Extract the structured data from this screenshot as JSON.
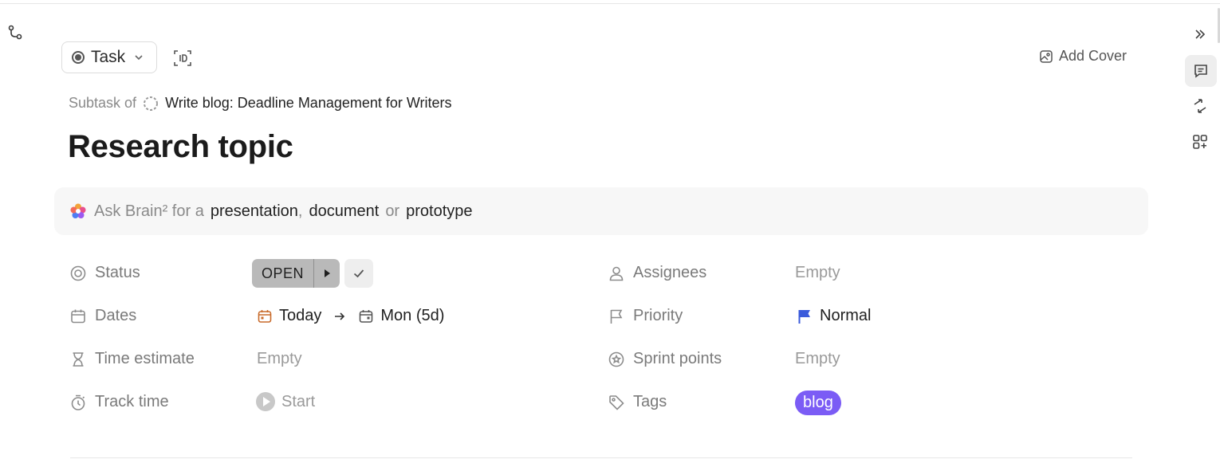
{
  "header": {
    "task_type_label": "Task",
    "add_cover_label": "Add Cover"
  },
  "breadcrumb": {
    "prefix": "Subtask of",
    "parent_task": "Write blog: Deadline Management for Writers"
  },
  "task": {
    "title": "Research topic"
  },
  "brain_bar": {
    "prefix": "Ask Brain² for a",
    "option1": "presentation",
    "sep1": ",",
    "option2": "document",
    "sep2": "or",
    "option3": "prototype"
  },
  "properties": {
    "status": {
      "label": "Status",
      "value": "OPEN"
    },
    "dates": {
      "label": "Dates",
      "start": "Today",
      "end": "Mon (5d)"
    },
    "time_estimate": {
      "label": "Time estimate",
      "value": "Empty"
    },
    "track_time": {
      "label": "Track time",
      "value": "Start"
    },
    "assignees": {
      "label": "Assignees",
      "value": "Empty"
    },
    "priority": {
      "label": "Priority",
      "value": "Normal"
    },
    "sprint_points": {
      "label": "Sprint points",
      "value": "Empty"
    },
    "tags": {
      "label": "Tags",
      "value": "blog"
    }
  },
  "colors": {
    "tag_bg": "#7b5cf5",
    "priority_flag": "#3b5bdb",
    "status_bg": "#b9b9b9",
    "date_start_icon": "#c86a2a"
  },
  "icons": {
    "left": "relationship-icon",
    "id": "task-id-icon",
    "rail": [
      "expand-icon",
      "comments-icon",
      "activity-icon",
      "apps-icon"
    ]
  }
}
